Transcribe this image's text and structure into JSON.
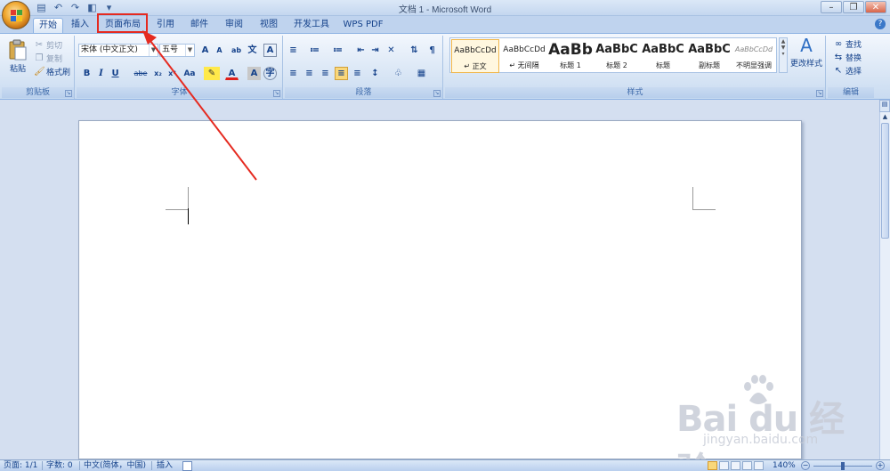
{
  "window": {
    "title": "文档 1 - Microsoft Word",
    "controls": [
      "minimize",
      "restore",
      "close"
    ]
  },
  "quick_access": {
    "icons": [
      "save-icon",
      "undo-icon",
      "redo-icon",
      "print-preview-icon",
      "customize-icon"
    ]
  },
  "tabs": [
    {
      "label": "开始",
      "active": true
    },
    {
      "label": "插入",
      "active": false
    },
    {
      "label": "页面布局",
      "active": false,
      "highlighted": true
    },
    {
      "label": "引用",
      "active": false
    },
    {
      "label": "邮件",
      "active": false
    },
    {
      "label": "审阅",
      "active": false
    },
    {
      "label": "视图",
      "active": false
    },
    {
      "label": "开发工具",
      "active": false
    },
    {
      "label": "WPS PDF",
      "active": false
    }
  ],
  "ribbon": {
    "clipboard": {
      "label": "剪贴板",
      "paste": "粘贴",
      "cut": "剪切",
      "copy": "复制",
      "format_painter": "格式刷"
    },
    "font": {
      "label": "字体",
      "font_name": "宋体 (中文正文)",
      "font_size": "五号",
      "buttons": [
        "B",
        "I",
        "U",
        "abe",
        "x₂",
        "x²",
        "Aa"
      ]
    },
    "paragraph": {
      "label": "段落"
    },
    "styles": {
      "label": "样式",
      "items": [
        {
          "sample": "AaBbCcDd",
          "name": "↵ 正文",
          "selected": true
        },
        {
          "sample": "AaBbCcDd",
          "name": "↵ 无间隔",
          "selected": false
        },
        {
          "sample": "AaBb",
          "name": "标题 1",
          "selected": false
        },
        {
          "sample": "AaBbC",
          "name": "标题 2",
          "selected": false
        },
        {
          "sample": "AaBbC",
          "name": "标题",
          "selected": false
        },
        {
          "sample": "AaBbC",
          "name": "副标题",
          "selected": false
        },
        {
          "sample": "AaBbCcDd",
          "name": "不明显强调",
          "selected": false
        }
      ],
      "change_styles": "更改样式"
    },
    "editing": {
      "label": "编辑",
      "find": "查找",
      "replace": "替换",
      "select": "选择"
    }
  },
  "statusbar": {
    "page": "页面: 1/1",
    "words": "字数: 0",
    "language": "中文(简体，中国)",
    "mode": "插入",
    "zoom": "140%"
  },
  "watermark": {
    "brand": "Bai du 经验",
    "url": "jingyan.baidu.com"
  },
  "colors": {
    "ribbon_text": "#15428b",
    "highlight_box": "#e52a20",
    "arrow": "#e52a20"
  }
}
